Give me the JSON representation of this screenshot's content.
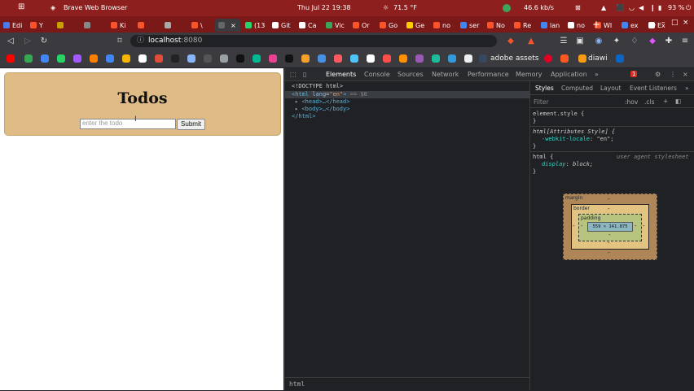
{
  "system_bar": {
    "app_name": "Brave Web Browser",
    "datetime": "Thu Jul 22  19:38",
    "weather": "71.5 °F",
    "network": "46.6 kb/s",
    "battery": "93 %"
  },
  "tabs": [
    {
      "label": "Edi",
      "color": "#4b7bec"
    },
    {
      "label": "Y",
      "color": "#fb542b"
    },
    {
      "label": "",
      "color": "#c8a000"
    },
    {
      "label": "",
      "color": "#888888"
    },
    {
      "label": "Ki",
      "color": "#fb542b"
    },
    {
      "label": "",
      "color": "#fb542b"
    },
    {
      "label": "",
      "color": "#aaaaaa"
    },
    {
      "label": "\\",
      "color": "#fb542b"
    },
    {
      "label": "",
      "color": "#666666"
    },
    {
      "label": "(13",
      "color": "#25d366"
    },
    {
      "label": "Git",
      "color": "#ffffff"
    },
    {
      "label": "Ca",
      "color": "#ffffff"
    },
    {
      "label": "Vic",
      "color": "#3ba55c"
    },
    {
      "label": "Or",
      "color": "#fb542b"
    },
    {
      "label": "Go",
      "color": "#fb542b"
    },
    {
      "label": "Ge",
      "color": "#ffcc00"
    },
    {
      "label": "no",
      "color": "#fb542b"
    },
    {
      "label": "ser",
      "color": "#4285f4"
    },
    {
      "label": "No",
      "color": "#fb542b"
    },
    {
      "label": "Re",
      "color": "#fb542b"
    },
    {
      "label": "lan",
      "color": "#4285f4"
    },
    {
      "label": "no",
      "color": "#ffffff"
    },
    {
      "label": "WI",
      "color": "#fb542b"
    },
    {
      "label": "ex",
      "color": "#4285f4"
    },
    {
      "label": "Ex",
      "color": "#ffffff"
    }
  ],
  "address_bar": {
    "host": "localhost",
    "port": ":8080"
  },
  "bookmarks": {
    "adobe": "adobe assets",
    "diawi": "diawi"
  },
  "page": {
    "title": "Todos",
    "input_placeholder": "enter the todo",
    "submit_label": "Submit"
  },
  "devtools": {
    "tabs": [
      "Elements",
      "Console",
      "Sources",
      "Network",
      "Performance",
      "Memory",
      "Application"
    ],
    "more": "»",
    "badge": "1",
    "dom": {
      "doctype": "<!DOCTYPE html>",
      "html_open": "<html",
      "lang_attr": "lang",
      "lang_val": "\"en\"",
      "html_close_bracket": ">",
      "selected_marker": "== $0",
      "head": "<head>…</head>",
      "body": "<body>…</body>",
      "html_end": "</html>"
    },
    "breadcrumb": "html",
    "styles_tabs": [
      "Styles",
      "Computed",
      "Layout",
      "Event Listeners"
    ],
    "filter_placeholder": "Filter",
    "hov": ":hov",
    "cls": ".cls",
    "rules": {
      "element_style": "element.style {",
      "close": "}",
      "attr_style_selector": "html[Attributes Style] {",
      "locale_prop": "-webkit-locale",
      "locale_val": "\"en\";",
      "html_selector": "html {",
      "ua_label": "user agent stylesheet",
      "display_prop": "display",
      "display_val": "block;"
    },
    "box_model": {
      "margin_label": "margin",
      "border_label": "border",
      "padding_label": "padding",
      "dash": "-",
      "content_size": "559 × 141.875"
    }
  }
}
